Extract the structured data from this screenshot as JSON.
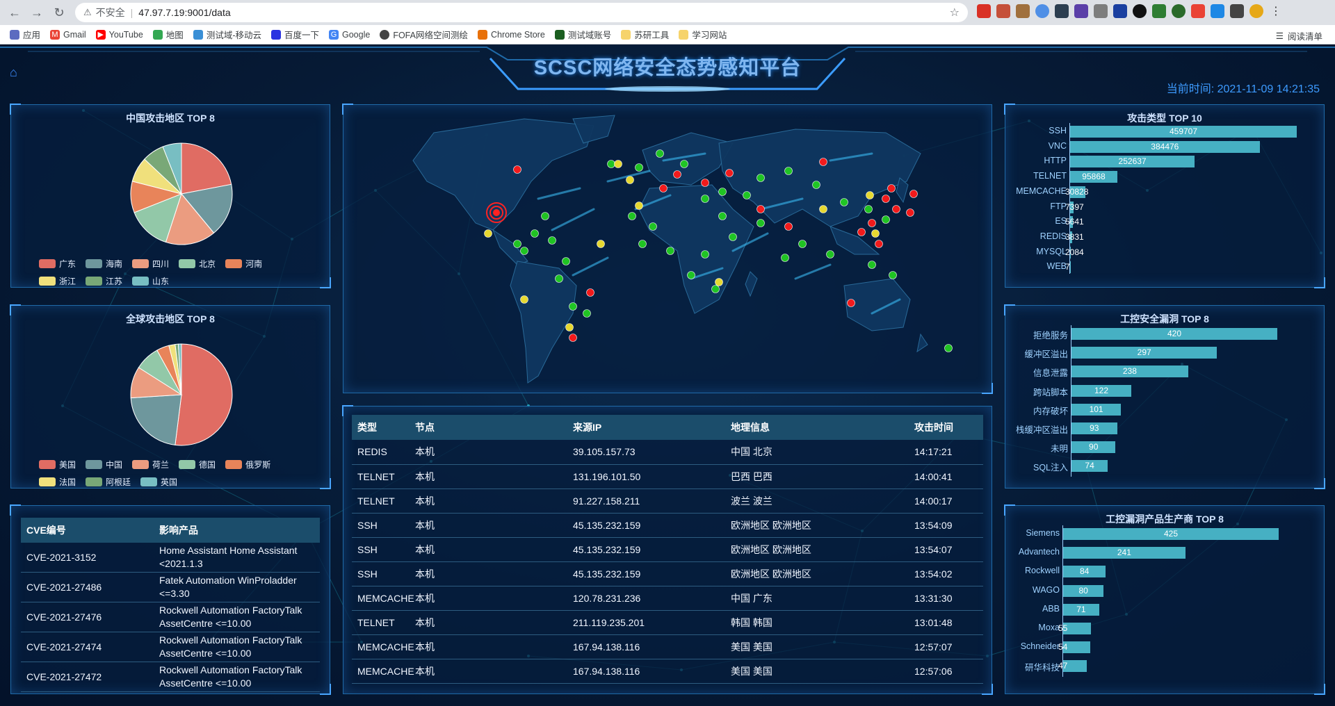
{
  "browser": {
    "security_label": "不安全",
    "url": "47.97.7.19:9001/data",
    "bookmarks": [
      {
        "label": "应用",
        "icon": "apps-icon"
      },
      {
        "label": "Gmail",
        "icon": "gmail-icon"
      },
      {
        "label": "YouTube",
        "icon": "youtube-icon"
      },
      {
        "label": "地图",
        "icon": "maps-icon"
      },
      {
        "label": "测试域-移动云",
        "icon": "cloud-icon"
      },
      {
        "label": "百度一下",
        "icon": "baidu-icon"
      },
      {
        "label": "Google",
        "icon": "google-icon"
      },
      {
        "label": "FOFA网络空间测绘",
        "icon": "fofa-icon"
      },
      {
        "label": "Chrome Store",
        "icon": "chrome-store-icon"
      },
      {
        "label": "测试域账号",
        "icon": "account-icon"
      },
      {
        "label": "苏研工具",
        "icon": "folder-icon"
      },
      {
        "label": "学习网站",
        "icon": "folder-icon"
      }
    ],
    "reading_list": "阅读清单"
  },
  "header": {
    "title": "SCSC网络安全态势感知平台",
    "clock": "当前时间: 2021-11-09 14:21:35"
  },
  "colors": {
    "bar": "#46b0c3",
    "map_land": "#0f3760",
    "map_border": "#2b6e9d",
    "dot_red": "#ff1a1a",
    "dot_green": "#22cc22",
    "dot_yellow": "#f2e230"
  },
  "china_pie": {
    "title": "中国攻击地区 TOP 8",
    "labels": [
      "广东",
      "海南",
      "四川",
      "北京",
      "河南",
      "浙江",
      "江苏",
      "山东"
    ],
    "values": [
      22,
      17,
      16,
      14,
      10,
      8,
      7,
      6
    ],
    "colors": [
      "#e06c63",
      "#6e979d",
      "#eb9c80",
      "#92c8a8",
      "#e8845a",
      "#f0e07c",
      "#79a877",
      "#78bec2"
    ]
  },
  "world_pie": {
    "title": "全球攻击地区 TOP 8",
    "labels": [
      "美国",
      "中国",
      "荷兰",
      "德国",
      "俄罗斯",
      "法国",
      "阿根廷",
      "英国"
    ],
    "values": [
      52,
      22,
      10,
      8,
      4,
      2,
      1,
      1
    ],
    "colors": [
      "#e06c63",
      "#6e979d",
      "#eb9c80",
      "#92c8a8",
      "#e8845a",
      "#f0e07c",
      "#79a877",
      "#78bec2"
    ]
  },
  "cve_table": {
    "headers": [
      "CVE编号",
      "影响产品"
    ],
    "rows": [
      [
        "CVE-2021-3152",
        "Home Assistant Home Assistant <2021.1.3"
      ],
      [
        "CVE-2021-27486",
        "Fatek Automation WinProladder <=3.30"
      ],
      [
        "CVE-2021-27476",
        "Rockwell Automation FactoryTalk AssetCentre <=10.00"
      ],
      [
        "CVE-2021-27474",
        "Rockwell Automation FactoryTalk AssetCentre <=10.00"
      ],
      [
        "CVE-2021-27472",
        "Rockwell Automation FactoryTalk AssetCentre <=10.00"
      ]
    ]
  },
  "attack_table": {
    "headers": [
      "类型",
      "节点",
      "来源IP",
      "地理信息",
      "攻击时间"
    ],
    "rows": [
      [
        "REDIS",
        "本机",
        "39.105.157.73",
        "中国 北京",
        "14:17:21"
      ],
      [
        "TELNET",
        "本机",
        "131.196.101.50",
        "巴西 巴西",
        "14:00:41"
      ],
      [
        "TELNET",
        "本机",
        "91.227.158.211",
        "波兰 波兰",
        "14:00:17"
      ],
      [
        "SSH",
        "本机",
        "45.135.232.159",
        "欧洲地区 欧洲地区",
        "13:54:09"
      ],
      [
        "SSH",
        "本机",
        "45.135.232.159",
        "欧洲地区 欧洲地区",
        "13:54:07"
      ],
      [
        "SSH",
        "本机",
        "45.135.232.159",
        "欧洲地区 欧洲地区",
        "13:54:02"
      ],
      [
        "MEMCACHE",
        "本机",
        "120.78.231.236",
        "中国 广东",
        "13:31:30"
      ],
      [
        "TELNET",
        "本机",
        "211.119.235.201",
        "韩国 韩国",
        "13:01:48"
      ],
      [
        "MEMCACHE",
        "本机",
        "167.94.138.116",
        "美国 美国",
        "12:57:07"
      ],
      [
        "MEMCACHE",
        "本机",
        "167.94.138.116",
        "美国 美国",
        "12:57:06"
      ]
    ]
  },
  "chart_data": [
    {
      "type": "bar",
      "title": "攻击类型 TOP 10",
      "orientation": "horizontal",
      "categories": [
        "SSH",
        "VNC",
        "HTTP",
        "TELNET",
        "MEMCACHE",
        "FTP",
        "ES",
        "REDIS",
        "MYSQL",
        "WEB"
      ],
      "values": [
        459707,
        384476,
        252637,
        95868,
        30828,
        7397,
        5641,
        3831,
        2084,
        7
      ]
    },
    {
      "type": "bar",
      "title": "工控安全漏洞 TOP 8",
      "orientation": "horizontal",
      "categories": [
        "拒绝服务",
        "缓冲区溢出",
        "信息泄露",
        "跨站脚本",
        "内存破坏",
        "栈缓冲区溢出",
        "未明",
        "SQL注入"
      ],
      "values": [
        420,
        297,
        238,
        122,
        101,
        93,
        90,
        74
      ]
    },
    {
      "type": "bar",
      "title": "工控漏洞产品生产商 TOP 8",
      "orientation": "horizontal",
      "categories": [
        "Siemens",
        "Advantech",
        "Rockwell",
        "WAGO",
        "ABB",
        "Moxa",
        "Schneider",
        "研华科技"
      ],
      "values": [
        425,
        241,
        84,
        80,
        71,
        55,
        54,
        47
      ]
    }
  ]
}
